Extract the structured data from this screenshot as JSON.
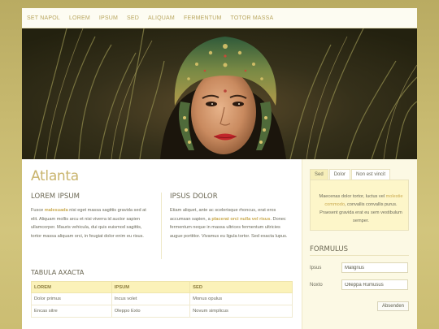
{
  "nav": {
    "items": [
      "SET NAPOL",
      "LOREM",
      "IPSUM",
      "SED",
      "ALIQUAM",
      "FERMENTUM",
      "TOTOR MASSA"
    ]
  },
  "main": {
    "site_title": "Atlanta",
    "col_left": {
      "heading": "LOREM IPSUM",
      "text_before": "Fusce ",
      "highlight": "malesuada",
      "text_after": " nisi eget massa sagittis gravida sed at elit. Aliquam mollis arcu et nisi viverra id auctor sapien ullamcorper. Mauris vehicula, dui quis euismod sagittis, tortor massa aliquam orci, in feugiat dolor enim eu risus."
    },
    "col_right": {
      "heading": "IPSUS DOLOR",
      "text_before": "Etiam aliquet, ante ac scelerisque rhoncus, erat eros accumsan sapien, a ",
      "highlight": "placerat orci nulla vel risus",
      "text_after": ". Donec fermentum neque in massa ultrices fermentum ultricies augue porttitor. Vivamus eu ligula tortor. Sed exacta lupus."
    },
    "table": {
      "title": "TABULA AXACTA",
      "headers": [
        "LOREM",
        "IPSUM",
        "SED"
      ],
      "rows": [
        [
          "Dolor primus",
          "Incus volet",
          "Monus opulus"
        ],
        [
          "Encas sitre",
          "Oleppo Exto",
          "Novum simplicus"
        ]
      ]
    }
  },
  "sidebar": {
    "tabs": [
      "Sed",
      "Dolor",
      "Non est vincit"
    ],
    "panel": {
      "text_before": "Maecenas dolor tortor, luctus vel ",
      "highlight": "molestie commodo",
      "text_after": ", convallis convallis purus. Praesent gravida erat eu sem vestibulum semper."
    },
    "form": {
      "title": "FORMULUS",
      "field1_label": "Ipsus",
      "field1_value": "Malignus",
      "field2_label": "Noxto",
      "field2_value": "Olleppa Rumusus",
      "submit_label": "Absenden"
    }
  },
  "colors": {
    "accent": "#c9b46d",
    "background": "#c7b96f",
    "table_header": "#fbf2b9",
    "sidebar_panel": "#fdf6c9"
  }
}
